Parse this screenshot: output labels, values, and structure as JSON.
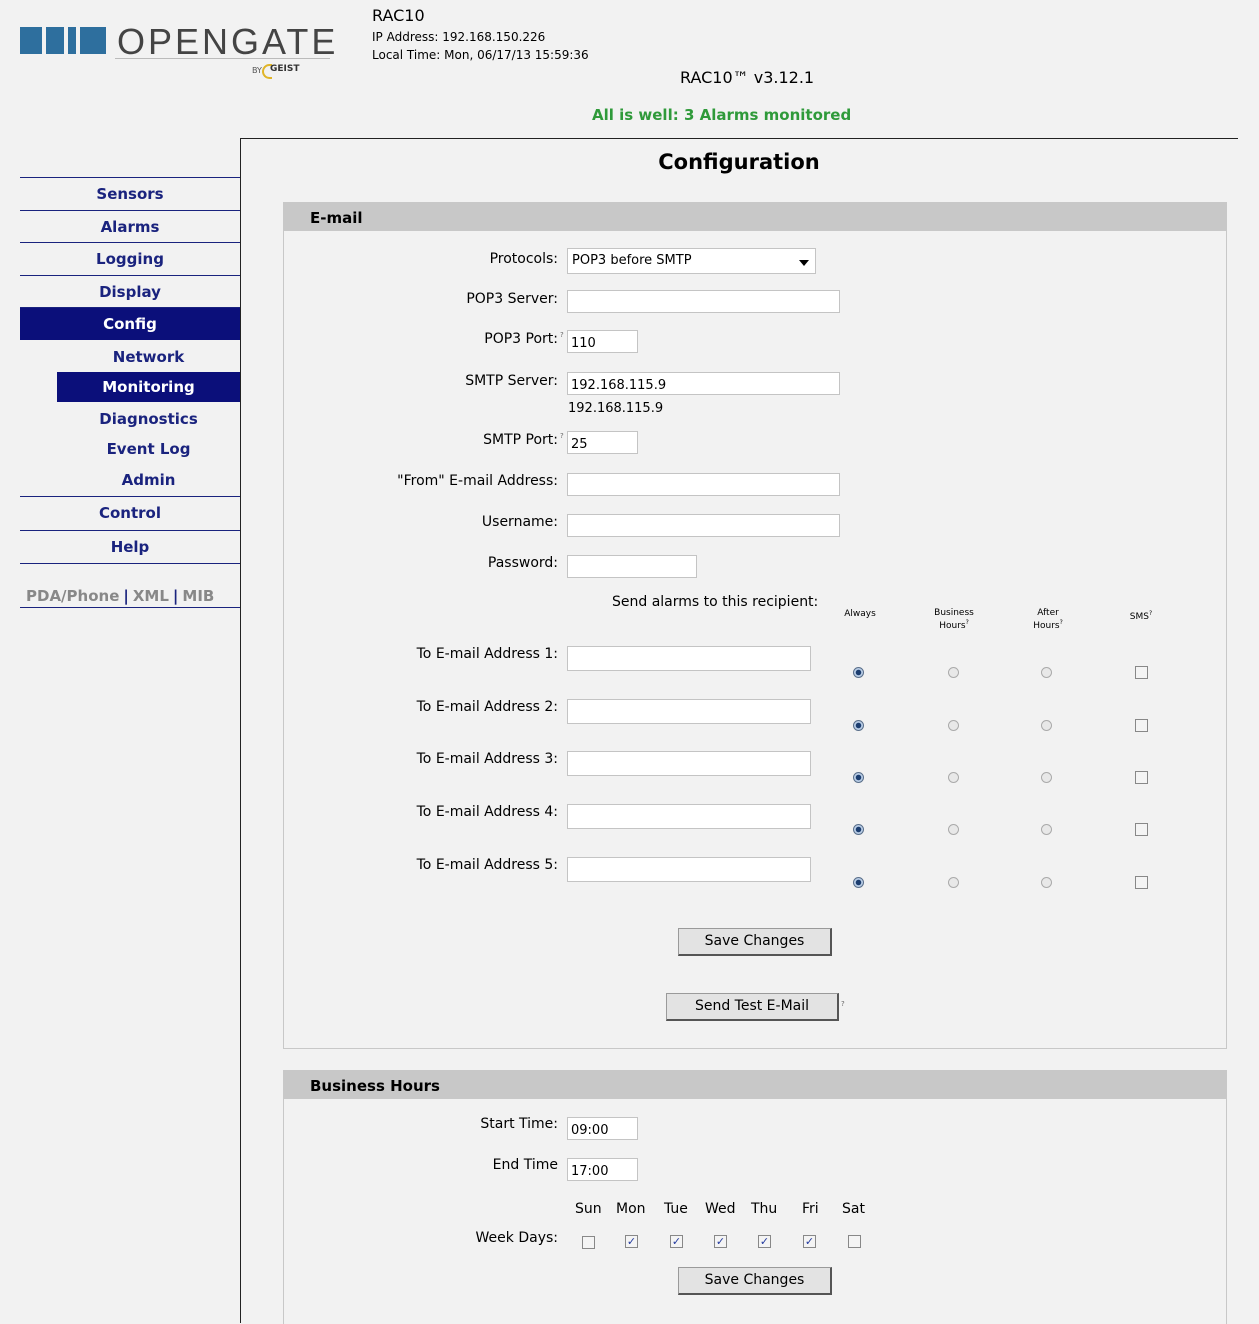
{
  "header": {
    "logo_text": "OPENGATE",
    "logo_by": "BY",
    "logo_brand": "GEIST",
    "device_name": "RAC10",
    "ip_address": "IP Address: 192.168.150.226",
    "local_time": "Local Time: Mon, 06/17/13 15:59:36",
    "version": "RAC10™ v3.12.1",
    "status": "All is well: 3 Alarms monitored",
    "status_color": "#2f9a3a"
  },
  "sidebar": {
    "items": [
      {
        "label": "Sensors"
      },
      {
        "label": "Alarms"
      },
      {
        "label": "Logging"
      },
      {
        "label": "Display"
      },
      {
        "label": "Config"
      }
    ],
    "sub_items": [
      {
        "label": "Network"
      },
      {
        "label": "Monitoring"
      },
      {
        "label": "Diagnostics"
      },
      {
        "label": "Event Log"
      },
      {
        "label": "Admin"
      }
    ],
    "bottom_items": [
      {
        "label": "Control"
      },
      {
        "label": "Help"
      }
    ],
    "links": [
      "PDA/Phone",
      "XML",
      "MIB"
    ],
    "active_item": "Config",
    "active_sub_item": "Monitoring"
  },
  "page": {
    "title": "Configuration"
  },
  "email": {
    "title": "E-mail",
    "protocols_label": "Protocols:",
    "protocols_value": "POP3 before SMTP",
    "pop3_server_label": "POP3 Server:",
    "pop3_server_value": "",
    "pop3_port_label": "POP3 Port:",
    "pop3_port_value": "110",
    "smtp_server_label": "SMTP Server:",
    "smtp_server_value": "192.168.115.9",
    "smtp_server_resolved": "192.168.115.9",
    "smtp_port_label": "SMTP Port:",
    "smtp_port_value": "25",
    "from_label": "\"From\" E-mail Address:",
    "from_value": "",
    "username_label": "Username:",
    "username_value": "",
    "password_label": "Password:",
    "password_value": "",
    "recipient_label": "Send alarms to this recipient:",
    "columns": {
      "always": "Always",
      "business_line1": "Business",
      "business_line2": "Hours",
      "after_line1": "After",
      "after_line2": "Hours",
      "sms": "SMS"
    },
    "help_mark": "?",
    "recipients": [
      {
        "label": "To E-mail Address 1:",
        "value": "",
        "schedule": "always",
        "sms": false
      },
      {
        "label": "To E-mail Address 2:",
        "value": "",
        "schedule": "always",
        "sms": false
      },
      {
        "label": "To E-mail Address 3:",
        "value": "",
        "schedule": "always",
        "sms": false
      },
      {
        "label": "To E-mail Address 4:",
        "value": "",
        "schedule": "always",
        "sms": false
      },
      {
        "label": "To E-mail Address 5:",
        "value": "",
        "schedule": "always",
        "sms": false
      }
    ],
    "save_label": "Save Changes",
    "test_label": "Send Test E-Mail"
  },
  "business_hours": {
    "title": "Business Hours",
    "start_label": "Start Time:",
    "start_value": "09:00",
    "end_label": "End Time",
    "end_value": "17:00",
    "weekdays_label": "Week Days:",
    "days": [
      {
        "name": "Sun",
        "checked": false
      },
      {
        "name": "Mon",
        "checked": true
      },
      {
        "name": "Tue",
        "checked": true
      },
      {
        "name": "Wed",
        "checked": true
      },
      {
        "name": "Thu",
        "checked": true
      },
      {
        "name": "Fri",
        "checked": true
      },
      {
        "name": "Sat",
        "checked": false
      }
    ],
    "save_label": "Save Changes"
  }
}
